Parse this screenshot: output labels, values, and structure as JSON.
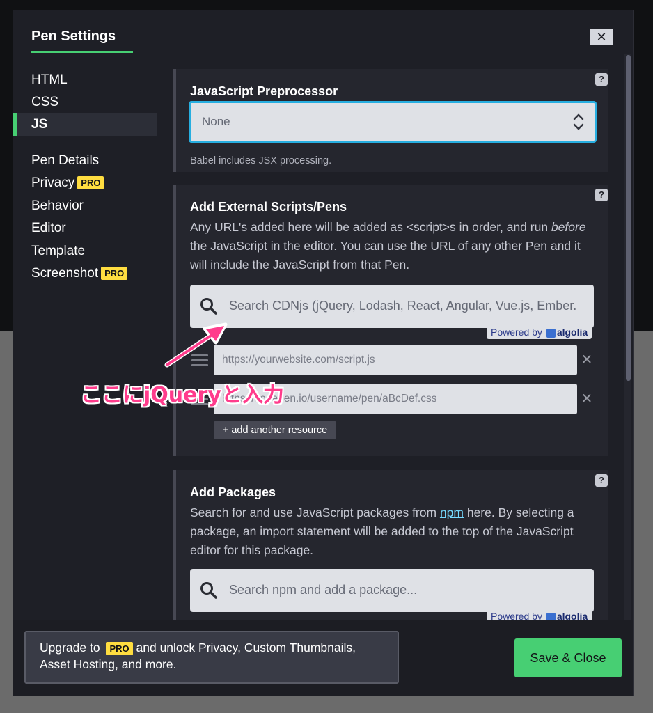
{
  "modal": {
    "title": "Pen Settings",
    "close_label": "✕"
  },
  "nav": {
    "items": [
      {
        "label": "HTML",
        "pro": false,
        "active": false
      },
      {
        "label": "CSS",
        "pro": false,
        "active": false
      },
      {
        "label": "JS",
        "pro": false,
        "active": true
      },
      {
        "label": "Pen Details",
        "pro": false,
        "active": false
      },
      {
        "label": "Privacy",
        "pro": true,
        "active": false
      },
      {
        "label": "Behavior",
        "pro": false,
        "active": false
      },
      {
        "label": "Editor",
        "pro": false,
        "active": false
      },
      {
        "label": "Template",
        "pro": false,
        "active": false
      },
      {
        "label": "Screenshot",
        "pro": true,
        "active": false
      }
    ],
    "pro_label": "PRO"
  },
  "preprocessor": {
    "label": "JavaScript Preprocessor",
    "selected": "None",
    "hint": "Babel includes JSX processing."
  },
  "external": {
    "label": "Add External Scripts/Pens",
    "desc_before": "Any URL's added here will be added as <script>s in order, and run ",
    "desc_em": "before",
    "desc_after": " the JavaScript in the editor. You can use the URL of any other Pen and it will include the JavaScript from that Pen.",
    "search_placeholder": "Search CDNjs (jQuery, Lodash, React, Angular, Vue.js, Ember.",
    "powered_by": "Powered by",
    "algolia": "algolia",
    "resources": [
      "https://yourwebsite.com/script.js",
      "https://codepen.io/username/pen/aBcDef.css"
    ],
    "add_resource": "+ add another resource"
  },
  "packages": {
    "label": "Add Packages",
    "desc_before": "Search for and use JavaScript packages from ",
    "desc_link": "npm",
    "desc_after": " here. By selecting a package, an import statement will be added to the top of the JavaScript editor for this package.",
    "search_placeholder": "Search npm and add a package...",
    "powered_by": "Powered by",
    "algolia": "algolia"
  },
  "annotation": {
    "text": "ここにjQueryと入力"
  },
  "footer": {
    "upgrade_prefix": "Upgrade to",
    "upgrade_pro": "PRO",
    "upgrade_suffix": "and unlock Privacy, Custom Thumbnails, Asset Hosting, and more.",
    "save_label": "Save & Close"
  },
  "help_icon": "?",
  "colors": {
    "accent_green": "#47cf73",
    "focus_blue": "#27aee0",
    "pro_yellow": "#ffdd40",
    "annotation_pink": "#ff3c8c"
  }
}
